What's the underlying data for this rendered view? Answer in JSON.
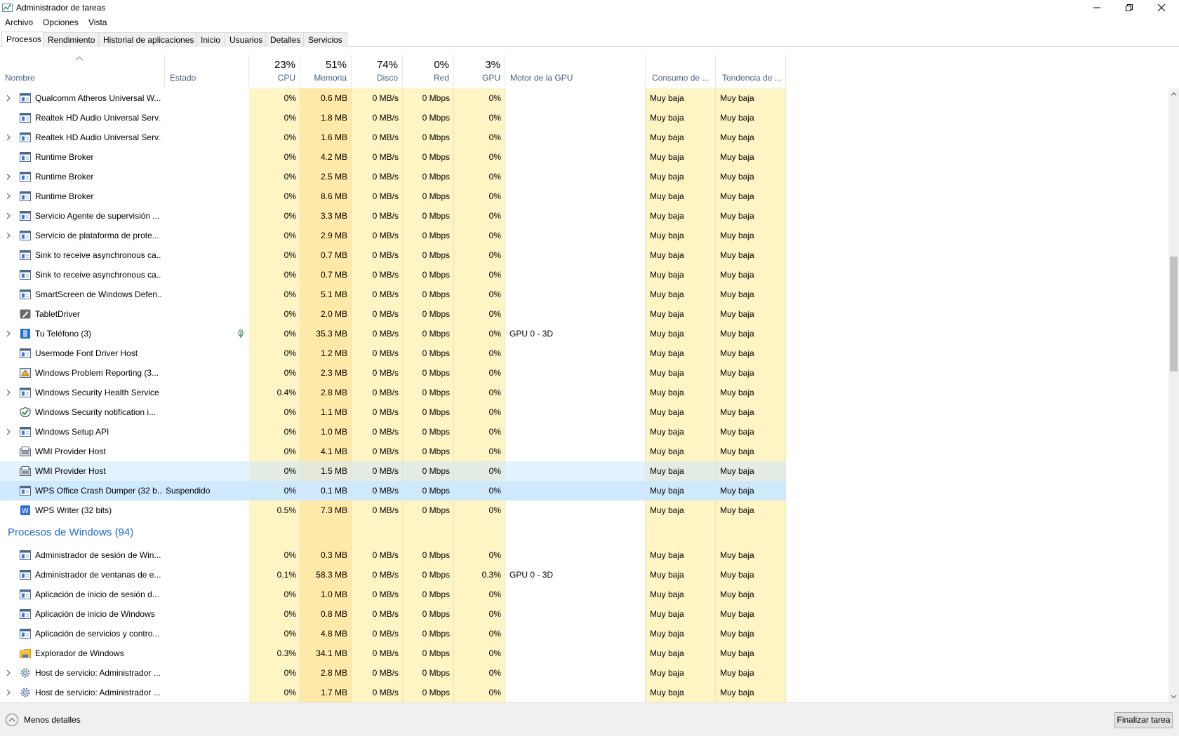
{
  "window": {
    "title": "Administrador de tareas"
  },
  "menu": [
    "Archivo",
    "Opciones",
    "Vista"
  ],
  "tabs": [
    "Procesos",
    "Rendimiento",
    "Historial de aplicaciones",
    "Inicio",
    "Usuarios",
    "Detalles",
    "Servicios"
  ],
  "active_tab": "Procesos",
  "columns": {
    "name": "Nombre",
    "status": "Estado",
    "cpu": {
      "pct": "23%",
      "label": "CPU"
    },
    "memory": {
      "pct": "51%",
      "label": "Memoria"
    },
    "disk": {
      "pct": "74%",
      "label": "Disco"
    },
    "network": {
      "pct": "0%",
      "label": "Red"
    },
    "gpu": {
      "pct": "3%",
      "label": "GPU"
    },
    "gpu_engine": "Motor de la GPU",
    "power": "Consumo de ...",
    "power_trend": "Tendencia de ..."
  },
  "processes": [
    {
      "name": "Qualcomm Atheros Universal W...",
      "expand": true,
      "icon": "service-icon",
      "status": "",
      "cpu": "0%",
      "mem": "0.6 MB",
      "disk": "0 MB/s",
      "net": "0 Mbps",
      "gpu": "0%",
      "engine": "",
      "power": "Muy baja",
      "trend": "Muy baja"
    },
    {
      "name": "Realtek HD Audio Universal Serv...",
      "expand": false,
      "icon": "service-icon",
      "status": "",
      "cpu": "0%",
      "mem": "1.8 MB",
      "disk": "0 MB/s",
      "net": "0 Mbps",
      "gpu": "0%",
      "engine": "",
      "power": "Muy baja",
      "trend": "Muy baja"
    },
    {
      "name": "Realtek HD Audio Universal Serv...",
      "expand": true,
      "icon": "service-icon",
      "status": "",
      "cpu": "0%",
      "mem": "1.6 MB",
      "disk": "0 MB/s",
      "net": "0 Mbps",
      "gpu": "0%",
      "engine": "",
      "power": "Muy baja",
      "trend": "Muy baja"
    },
    {
      "name": "Runtime Broker",
      "expand": false,
      "icon": "service-icon",
      "status": "",
      "cpu": "0%",
      "mem": "4.2 MB",
      "disk": "0 MB/s",
      "net": "0 Mbps",
      "gpu": "0%",
      "engine": "",
      "power": "Muy baja",
      "trend": "Muy baja"
    },
    {
      "name": "Runtime Broker",
      "expand": true,
      "icon": "service-icon",
      "status": "",
      "cpu": "0%",
      "mem": "2.5 MB",
      "disk": "0 MB/s",
      "net": "0 Mbps",
      "gpu": "0%",
      "engine": "",
      "power": "Muy baja",
      "trend": "Muy baja"
    },
    {
      "name": "Runtime Broker",
      "expand": true,
      "icon": "service-icon",
      "status": "",
      "cpu": "0%",
      "mem": "8.6 MB",
      "disk": "0 MB/s",
      "net": "0 Mbps",
      "gpu": "0%",
      "engine": "",
      "power": "Muy baja",
      "trend": "Muy baja"
    },
    {
      "name": "Servicio Agente de supervisión ...",
      "expand": true,
      "icon": "service-icon",
      "status": "",
      "cpu": "0%",
      "mem": "3.3 MB",
      "disk": "0 MB/s",
      "net": "0 Mbps",
      "gpu": "0%",
      "engine": "",
      "power": "Muy baja",
      "trend": "Muy baja"
    },
    {
      "name": "Servicio de plataforma de prote...",
      "expand": true,
      "icon": "service-icon",
      "status": "",
      "cpu": "0%",
      "mem": "2.9 MB",
      "disk": "0 MB/s",
      "net": "0 Mbps",
      "gpu": "0%",
      "engine": "",
      "power": "Muy baja",
      "trend": "Muy baja"
    },
    {
      "name": "Sink to receive asynchronous ca...",
      "expand": false,
      "icon": "service-icon",
      "status": "",
      "cpu": "0%",
      "mem": "0.7 MB",
      "disk": "0 MB/s",
      "net": "0 Mbps",
      "gpu": "0%",
      "engine": "",
      "power": "Muy baja",
      "trend": "Muy baja"
    },
    {
      "name": "Sink to receive asynchronous ca...",
      "expand": false,
      "icon": "service-icon",
      "status": "",
      "cpu": "0%",
      "mem": "0.7 MB",
      "disk": "0 MB/s",
      "net": "0 Mbps",
      "gpu": "0%",
      "engine": "",
      "power": "Muy baja",
      "trend": "Muy baja"
    },
    {
      "name": "SmartScreen de Windows Defen...",
      "expand": false,
      "icon": "service-icon",
      "status": "",
      "cpu": "0%",
      "mem": "5.1 MB",
      "disk": "0 MB/s",
      "net": "0 Mbps",
      "gpu": "0%",
      "engine": "",
      "power": "Muy baja",
      "trend": "Muy baja"
    },
    {
      "name": "TabletDriver",
      "expand": false,
      "icon": "tablet-icon",
      "status": "",
      "cpu": "0%",
      "mem": "2.0 MB",
      "disk": "0 MB/s",
      "net": "0 Mbps",
      "gpu": "0%",
      "engine": "",
      "power": "Muy baja",
      "trend": "Muy baja"
    },
    {
      "name": "Tu Teléfono (3)",
      "expand": true,
      "icon": "phone-icon",
      "status": "",
      "leaf": true,
      "cpu": "0%",
      "mem": "35.3 MB",
      "disk": "0 MB/s",
      "net": "0 Mbps",
      "gpu": "0%",
      "engine": "GPU 0 - 3D",
      "power": "Muy baja",
      "trend": "Muy baja"
    },
    {
      "name": "Usermode Font Driver Host",
      "expand": false,
      "icon": "service-icon",
      "status": "",
      "cpu": "0%",
      "mem": "1.2 MB",
      "disk": "0 MB/s",
      "net": "0 Mbps",
      "gpu": "0%",
      "engine": "",
      "power": "Muy baja",
      "trend": "Muy baja"
    },
    {
      "name": "Windows Problem Reporting (3...",
      "expand": false,
      "icon": "report-icon",
      "status": "",
      "cpu": "0%",
      "mem": "2.3 MB",
      "disk": "0 MB/s",
      "net": "0 Mbps",
      "gpu": "0%",
      "engine": "",
      "power": "Muy baja",
      "trend": "Muy baja"
    },
    {
      "name": "Windows Security Health Service",
      "expand": true,
      "icon": "service-icon",
      "status": "",
      "cpu": "0.4%",
      "mem": "2.8 MB",
      "disk": "0 MB/s",
      "net": "0 Mbps",
      "gpu": "0%",
      "engine": "",
      "power": "Muy baja",
      "trend": "Muy baja"
    },
    {
      "name": "Windows Security notification i...",
      "expand": false,
      "icon": "shield-icon",
      "status": "",
      "cpu": "0%",
      "mem": "1.1 MB",
      "disk": "0 MB/s",
      "net": "0 Mbps",
      "gpu": "0%",
      "engine": "",
      "power": "Muy baja",
      "trend": "Muy baja"
    },
    {
      "name": "Windows Setup API",
      "expand": true,
      "icon": "service-icon",
      "status": "",
      "cpu": "0%",
      "mem": "1.0 MB",
      "disk": "0 MB/s",
      "net": "0 Mbps",
      "gpu": "0%",
      "engine": "",
      "power": "Muy baja",
      "trend": "Muy baja"
    },
    {
      "name": "WMI Provider Host",
      "expand": false,
      "icon": "wmi-icon",
      "status": "",
      "cpu": "0%",
      "mem": "4.1 MB",
      "disk": "0 MB/s",
      "net": "0 Mbps",
      "gpu": "0%",
      "engine": "",
      "power": "Muy baja",
      "trend": "Muy baja"
    },
    {
      "name": "WMI Provider Host",
      "expand": false,
      "icon": "wmi-icon",
      "status": "",
      "state": "hover",
      "cpu": "0%",
      "mem": "1.5 MB",
      "disk": "0 MB/s",
      "net": "0 Mbps",
      "gpu": "0%",
      "engine": "",
      "power": "Muy baja",
      "trend": "Muy baja"
    },
    {
      "name": "WPS Office Crash Dumper (32 b...",
      "expand": false,
      "icon": "service-icon",
      "status": "Suspendido",
      "state": "selected",
      "cpu": "0%",
      "mem": "0.1 MB",
      "disk": "0 MB/s",
      "net": "0 Mbps",
      "gpu": "0%",
      "engine": "",
      "power": "Muy baja",
      "trend": "Muy baja"
    },
    {
      "name": "WPS Writer (32 bits)",
      "expand": false,
      "icon": "wps-writer-icon",
      "status": "",
      "cpu": "0.5%",
      "mem": "7.3 MB",
      "disk": "0 MB/s",
      "net": "0 Mbps",
      "gpu": "0%",
      "engine": "",
      "power": "Muy baja",
      "trend": "Muy baja"
    }
  ],
  "windows_group": {
    "title": "Procesos de Windows (94)",
    "processes": [
      {
        "name": "Administrador de sesión de Win...",
        "expand": false,
        "icon": "service-icon",
        "status": "",
        "cpu": "0%",
        "mem": "0.3 MB",
        "disk": "0 MB/s",
        "net": "0 Mbps",
        "gpu": "0%",
        "engine": "",
        "power": "Muy baja",
        "trend": "Muy baja"
      },
      {
        "name": "Administrador de ventanas de e...",
        "expand": false,
        "icon": "service-icon",
        "status": "",
        "cpu": "0.1%",
        "mem": "58.3 MB",
        "disk": "0 MB/s",
        "net": "0 Mbps",
        "gpu": "0.3%",
        "engine": "GPU 0 - 3D",
        "power": "Muy baja",
        "trend": "Muy baja"
      },
      {
        "name": "Aplicación de inicio de sesión d...",
        "expand": false,
        "icon": "service-icon",
        "status": "",
        "cpu": "0%",
        "mem": "1.0 MB",
        "disk": "0 MB/s",
        "net": "0 Mbps",
        "gpu": "0%",
        "engine": "",
        "power": "Muy baja",
        "trend": "Muy baja"
      },
      {
        "name": "Aplicación de inicio de Windows",
        "expand": false,
        "icon": "service-icon",
        "status": "",
        "cpu": "0%",
        "mem": "0.8 MB",
        "disk": "0 MB/s",
        "net": "0 Mbps",
        "gpu": "0%",
        "engine": "",
        "power": "Muy baja",
        "trend": "Muy baja"
      },
      {
        "name": "Aplicación de servicios y contro...",
        "expand": false,
        "icon": "service-icon",
        "status": "",
        "cpu": "0%",
        "mem": "4.8 MB",
        "disk": "0 MB/s",
        "net": "0 Mbps",
        "gpu": "0%",
        "engine": "",
        "power": "Muy baja",
        "trend": "Muy baja"
      },
      {
        "name": "Explorador de Windows",
        "expand": false,
        "icon": "folder-icon",
        "status": "",
        "cpu": "0.3%",
        "mem": "34.1 MB",
        "disk": "0 MB/s",
        "net": "0 Mbps",
        "gpu": "0%",
        "engine": "",
        "power": "Muy baja",
        "trend": "Muy baja"
      },
      {
        "name": "Host de servicio: Administrador ...",
        "expand": true,
        "icon": "gear-icon",
        "status": "",
        "cpu": "0%",
        "mem": "2.8 MB",
        "disk": "0 MB/s",
        "net": "0 Mbps",
        "gpu": "0%",
        "engine": "",
        "power": "Muy baja",
        "trend": "Muy baja"
      },
      {
        "name": "Host de servicio: Administrador ...",
        "expand": true,
        "icon": "gear-icon",
        "status": "",
        "cpu": "0%",
        "mem": "1.7 MB",
        "disk": "0 MB/s",
        "net": "0 Mbps",
        "gpu": "0%",
        "engine": "",
        "power": "Muy baja",
        "trend": "Muy baja"
      }
    ]
  },
  "footer": {
    "less_details": "Menos detalles",
    "end_task": "Finalizar tarea"
  },
  "colors": {
    "heat_light": "#fff4c4",
    "heat_medium": "#ffe9a8",
    "selected": "#cce8ff",
    "group_title": "#1e6bd1",
    "header_label": "#4d6082"
  }
}
